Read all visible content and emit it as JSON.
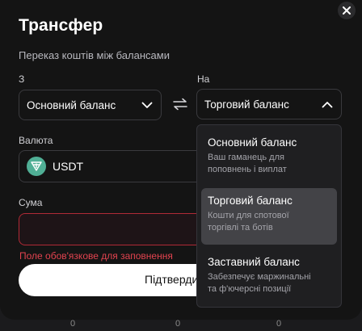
{
  "modal": {
    "title": "Трансфер",
    "subtitle": "Переказ коштів між балансами",
    "from_label": "З",
    "to_label": "На",
    "from_value": "Основний баланс",
    "to_value": "Торговий баланс",
    "currency_label": "Валюта",
    "currency_value": "USDT",
    "amount_label": "Сума",
    "amount_value": "",
    "error_text": "Поле обов'язкове для заповнення",
    "confirm_label": "Підтвердити"
  },
  "dropdown": {
    "options": [
      {
        "title": "Основний баланс",
        "desc_1": "Ваш гаманець для",
        "desc_2": "поповнень і виплат",
        "selected": false
      },
      {
        "title": "Торговий баланс",
        "desc_1": "Кошти для спотової",
        "desc_2": "торгівлі та ботів",
        "selected": true
      },
      {
        "title": "Заставний баланс",
        "desc_1": "Забезпечує маржинальні",
        "desc_2": "та ф'ючерсні позиції",
        "selected": false
      }
    ]
  },
  "background": {
    "zeros": [
      "0",
      "0",
      "0"
    ]
  },
  "colors": {
    "error": "#e2434f",
    "usdt": "#50af95",
    "highlight": "#434347"
  },
  "icons": [
    "close-icon",
    "chevron-down-icon",
    "chevron-up-icon",
    "swap-arrows-icon",
    "usdt-icon"
  ]
}
